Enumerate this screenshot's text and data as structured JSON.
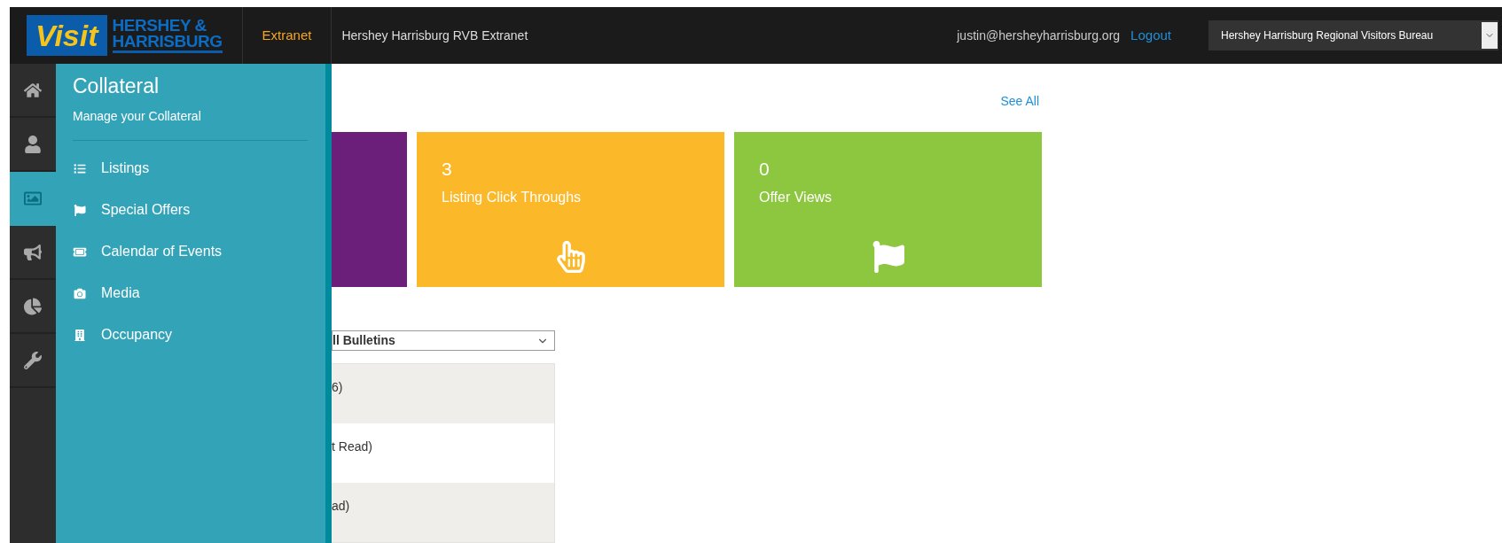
{
  "header": {
    "logo": {
      "word": "Visit",
      "line1": "HERSHEY &",
      "line2": "HARRISBURG"
    },
    "app_label": "Extranet",
    "site_title": "Hershey Harrisburg RVB Extranet",
    "user_email": "justin@hersheyharrisburg.org",
    "logout": "Logout",
    "organization_select": {
      "value": "Hershey Harrisburg Regional Visitors Bureau"
    }
  },
  "rail": [
    {
      "kind": "home",
      "selected": false
    },
    {
      "kind": "user",
      "selected": false
    },
    {
      "kind": "image",
      "selected": true
    },
    {
      "kind": "megaphone",
      "selected": false
    },
    {
      "kind": "pie",
      "selected": false
    },
    {
      "kind": "wrench",
      "selected": false
    }
  ],
  "flyout": {
    "title": "Collateral",
    "subtitle": "Manage your Collateral",
    "items": [
      {
        "kind": "list",
        "label": "Listings"
      },
      {
        "kind": "flag",
        "label": "Special Offers"
      },
      {
        "kind": "ticket",
        "label": "Calendar of Events"
      },
      {
        "kind": "camera",
        "label": "Media"
      },
      {
        "kind": "building",
        "label": "Occupancy"
      }
    ]
  },
  "main": {
    "see_all": "See All",
    "cards": [
      {
        "kind": "blank",
        "color": "#6b1f7a"
      },
      {
        "kind": "pointer",
        "color": "#fbb829",
        "value": "3",
        "label": "Listing Click Throughs"
      },
      {
        "kind": "flag",
        "color": "#8dc63f",
        "value": "0",
        "label": "Offer Views"
      }
    ],
    "bulletin_filter": {
      "value": "ll Bulletins"
    },
    "bulletins": [
      {
        "text": "6)"
      },
      {
        "text": "t Read)"
      },
      {
        "text": "ad)"
      }
    ]
  }
}
